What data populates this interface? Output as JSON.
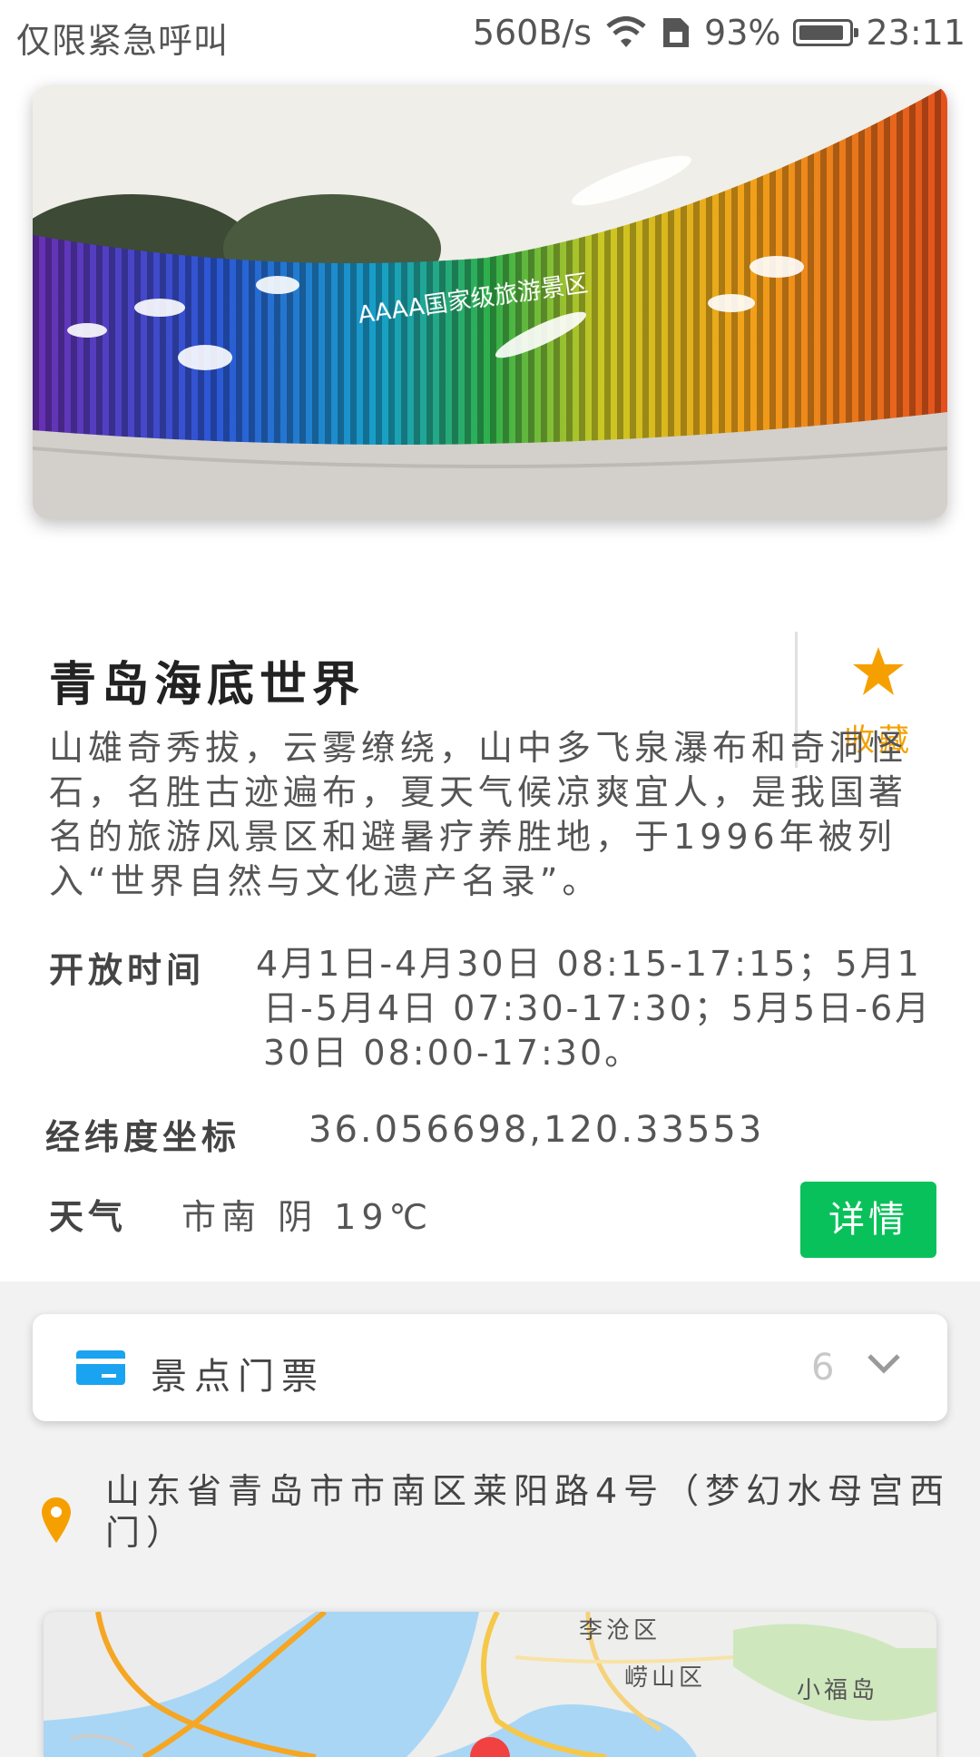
{
  "status_bar": {
    "carrier_text": "仅限紧急呼叫",
    "net_speed": "560B/s",
    "battery_percent": "93%",
    "battery_level": 0.93,
    "time": "23:11"
  },
  "scenic": {
    "title": "青岛海底世界",
    "favorite_label": "收藏",
    "description": "山雄奇秀拔，云雾缭绕，山中多飞泉瀑布和奇洞怪石，名胜古迹遍布，夏天气候凉爽宜人，是我国著名的旅游风景区和避暑疗养胜地，于1996年被列入“世界自然与文化遗产名录”。",
    "hours_label": "开放时间",
    "hours_value": "4月1日-4月30日 08:15-17:15；5月1日-5月4日 07:30-17:30；5月5日-6月30日 08:00-17:30。",
    "coords_label": "经纬度坐标",
    "coords_value": "36.056698,120.33553",
    "weather_label": "天气",
    "weather_value": "市南 阴 19℃",
    "detail_button": "详情"
  },
  "tickets": {
    "label": "景点门票",
    "count": "6"
  },
  "address": "山东省青岛市市南区莱阳路4号（梦幻水母宫西门）",
  "map": {
    "labels": [
      "李沧区",
      "崂山区",
      "小福岛"
    ]
  },
  "colors": {
    "accent_orange": "#f5a000",
    "button_green": "#09c15b",
    "ticket_blue": "#1aa3f0"
  },
  "icons": [
    "wifi-icon",
    "sim-icon",
    "battery-icon",
    "star-icon",
    "ticket-card-icon",
    "chevron-down-icon",
    "location-pin-icon",
    "map-marker-icon"
  ]
}
